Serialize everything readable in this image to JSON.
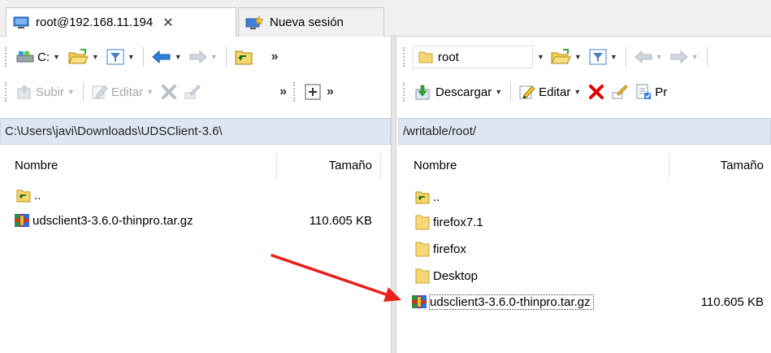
{
  "tabs": [
    {
      "label": "root@192.168.11.194",
      "close": "✕",
      "icon": "monitor-icon"
    },
    {
      "label": "Nueva sesión",
      "icon": "new-session-icon"
    }
  ],
  "left_panel": {
    "drive_label": "C:",
    "toolbar2": {
      "upload_label": "Subir",
      "edit_label": "Editar"
    },
    "path": "C:\\Users\\javi\\Downloads\\UDSClient-3.6\\",
    "columns": {
      "name": "Nombre",
      "size": "Tamaño"
    },
    "files": [
      {
        "name": "..",
        "size": "",
        "icon": "parent-folder-icon"
      },
      {
        "name": "udsclient3-3.6.0-thinpro.tar.gz",
        "size": "110.605 KB",
        "icon": "archive-icon"
      }
    ]
  },
  "right_panel": {
    "folder_label": "root",
    "toolbar2": {
      "download_label": "Descargar",
      "edit_label": "Editar",
      "properties_label": "Pr"
    },
    "path": "/writable/root/",
    "columns": {
      "name": "Nombre",
      "size": "Tamaño"
    },
    "files": [
      {
        "name": "..",
        "size": "",
        "icon": "parent-folder-icon"
      },
      {
        "name": "firefox7.1",
        "size": "",
        "icon": "folder-icon"
      },
      {
        "name": "firefox",
        "size": "",
        "icon": "folder-icon"
      },
      {
        "name": "Desktop",
        "size": "",
        "icon": "folder-icon"
      },
      {
        "name": "udsclient3-3.6.0-thinpro.tar.gz",
        "size": "110.605 KB",
        "icon": "archive-icon"
      }
    ]
  },
  "annotation": {
    "arrow_color": "#e8201c",
    "points_to": "udsclient3-3.6.0-thinpro.tar.gz"
  },
  "colors": {
    "path_bar": "#dde6f2",
    "folder": "#f7d774",
    "delete": "#e00000",
    "accent_blue": "#2f7fd8"
  }
}
